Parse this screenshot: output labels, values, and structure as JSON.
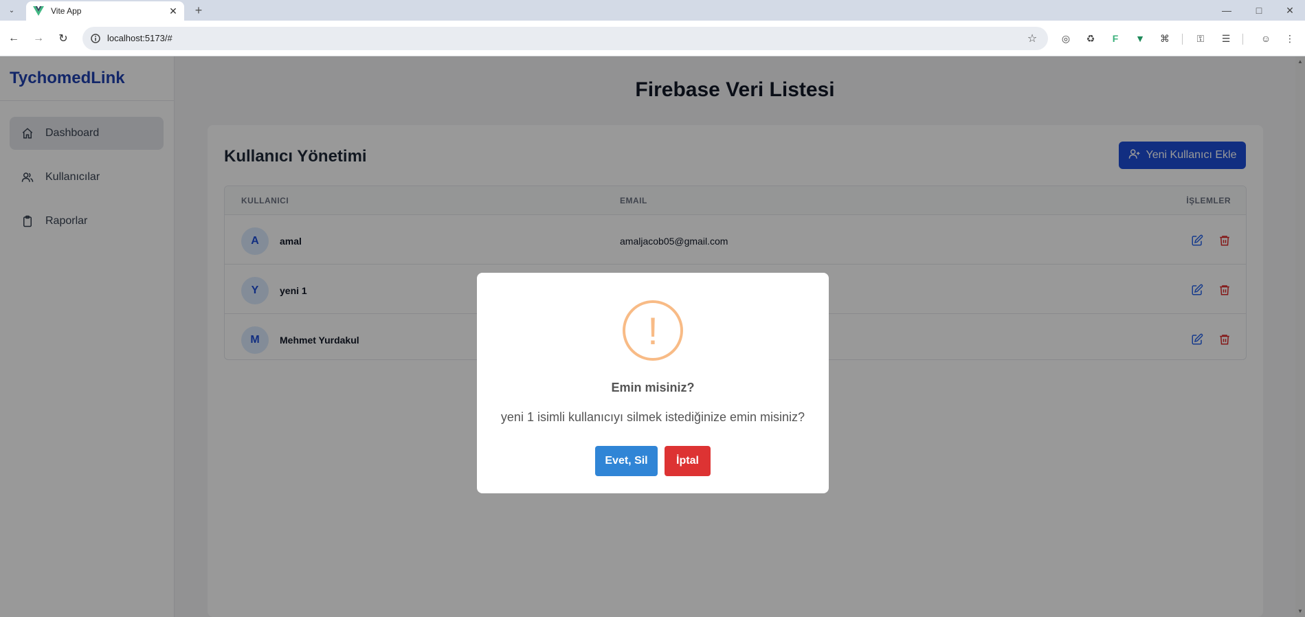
{
  "browser": {
    "tab_title": "Vite App",
    "url": "localhost:5173/#"
  },
  "sidebar": {
    "brand": "TychomedLink",
    "items": [
      {
        "label": "Dashboard",
        "icon": "home-icon",
        "active": true
      },
      {
        "label": "Kullanıcılar",
        "icon": "users-icon",
        "active": false
      },
      {
        "label": "Raporlar",
        "icon": "clipboard-icon",
        "active": false
      }
    ]
  },
  "main": {
    "title": "Firebase Veri Listesi",
    "card_heading": "Kullanıcı Yönetimi",
    "add_user_label": "Yeni Kullanıcı Ekle",
    "columns": [
      "KULLANICI",
      "EMAIL",
      "İŞLEMLER"
    ],
    "rows": [
      {
        "initial": "A",
        "name": "amal",
        "email": "amaljacob05@gmail.com"
      },
      {
        "initial": "Y",
        "name": "yeni 1",
        "email": ""
      },
      {
        "initial": "M",
        "name": "Mehmet Yurdakul",
        "email": ""
      }
    ]
  },
  "modal": {
    "icon": "warning-icon",
    "title": "Emin misiniz?",
    "text": "yeni 1 isimli kullanıcıyı silmek istediğinize emin misiniz?",
    "confirm_label": "Evet, Sil",
    "cancel_label": "İptal"
  },
  "colors": {
    "brand": "#1e40af",
    "primary_button": "#1d4ed8",
    "confirm": "#3085d6",
    "cancel": "#dd3333",
    "warning": "#f8bb86"
  }
}
